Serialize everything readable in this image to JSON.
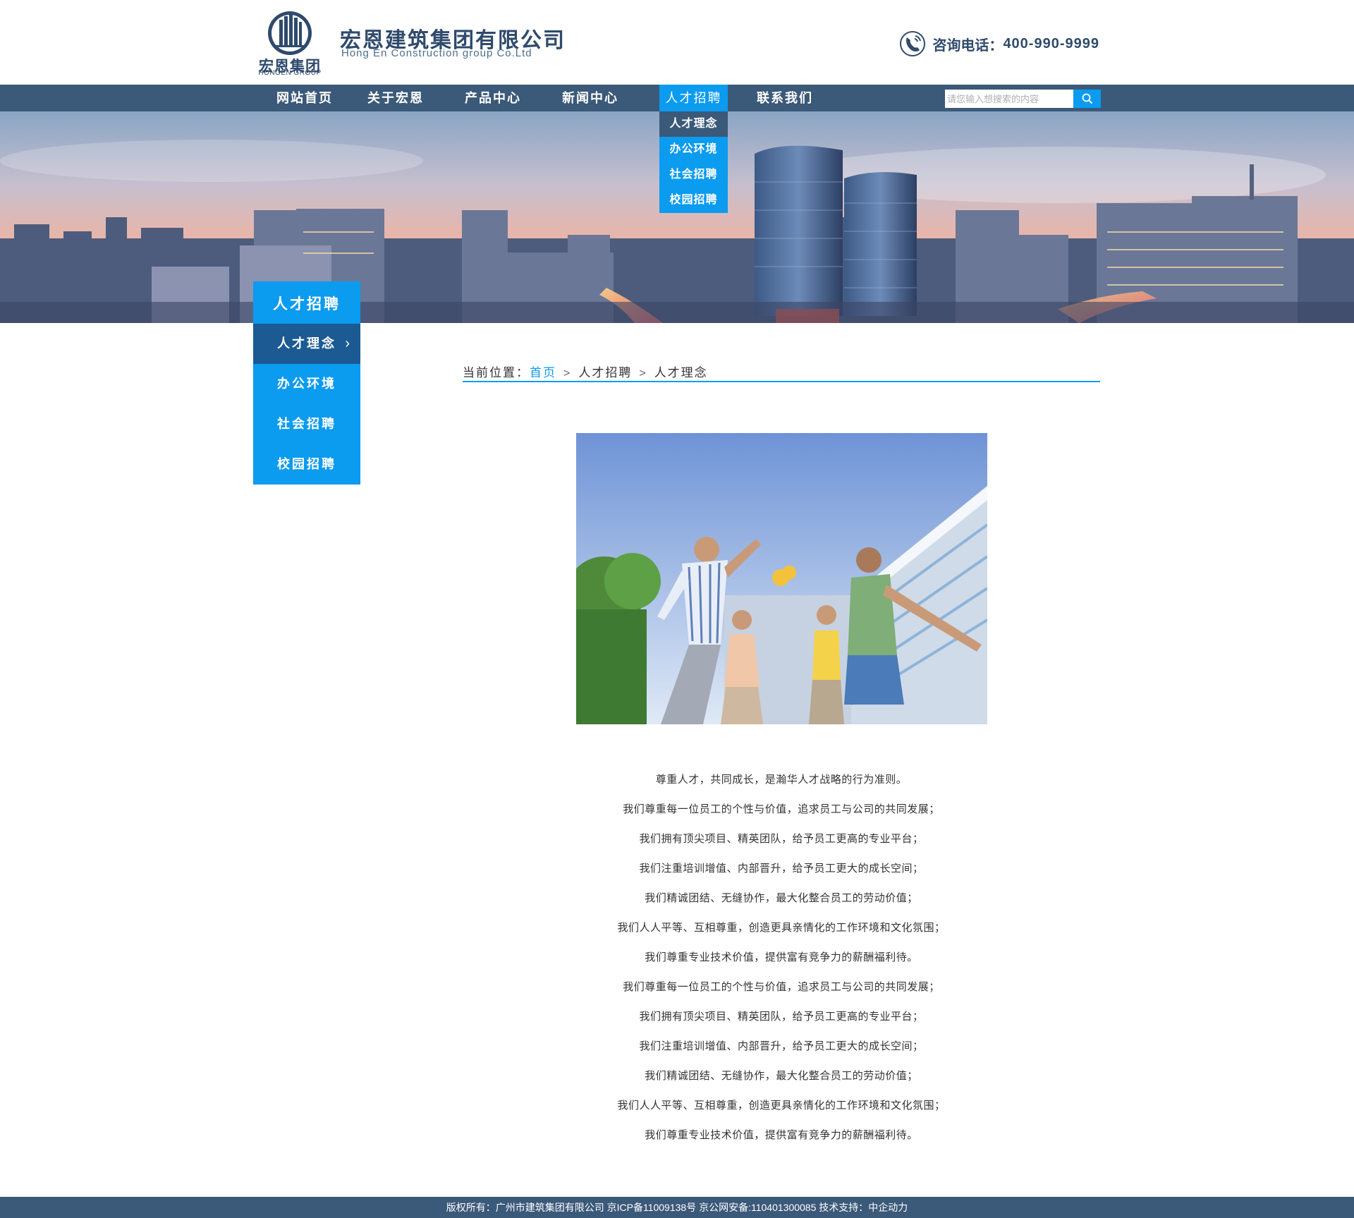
{
  "header": {
    "logo_cn": "宏恩集团",
    "logo_en": "HONGEN GROUP",
    "company_cn": "宏恩建筑集团有限公司",
    "company_en": "Hong En Construction group Co.Ltd",
    "hotline_label": "咨询电话：",
    "hotline_number": "400-990-9999",
    "phone_icon": "phone-icon",
    "brand_color": "#2f4a6c"
  },
  "nav": {
    "items": [
      {
        "label": "网站首页"
      },
      {
        "label": "关于宏恩"
      },
      {
        "label": "产品中心"
      },
      {
        "label": "新闻中心"
      },
      {
        "label": "人才招聘",
        "active": true
      },
      {
        "label": "联系我们"
      }
    ],
    "search_placeholder": "请您输入想搜索的内容",
    "search_icon": "search-icon",
    "bar_color": "#3b5979",
    "accent_color": "#0b9bef"
  },
  "dropdown": {
    "items": [
      {
        "label": "人才理念",
        "current": true
      },
      {
        "label": "办公环境"
      },
      {
        "label": "社会招聘"
      },
      {
        "label": "校园招聘"
      }
    ]
  },
  "side": {
    "title": "人才招聘",
    "items": [
      {
        "label": "人才理念",
        "current": true
      },
      {
        "label": "办公环境"
      },
      {
        "label": "社会招聘"
      },
      {
        "label": "校园招聘"
      }
    ],
    "arrow": "›"
  },
  "breadcrumb": {
    "prefix": "当前位置：",
    "home": "首页",
    "sep": ">",
    "level1": "人才招聘",
    "level2": "人才理念"
  },
  "content": {
    "lines": [
      "尊重人才，共同成长，是瀚华人才战略的行为准则。",
      "我们尊重每一位员工的个性与价值，追求员工与公司的共同发展；",
      "我们拥有顶尖项目、精英团队，给予员工更高的专业平台；",
      "我们注重培训增值、内部晋升，给予员工更大的成长空间；",
      "我们精诚团结、无缝协作，最大化整合员工的劳动价值；",
      "我们人人平等、互相尊重，创造更具亲情化的工作环境和文化氛围；",
      "我们尊重专业技术价值，提供富有竞争力的薪酬福利待。",
      "我们尊重每一位员工的个性与价值，追求员工与公司的共同发展；",
      "我们拥有顶尖项目、精英团队，给予员工更高的专业平台；",
      "我们注重培训增值、内部晋升，给予员工更大的成长空间；",
      "我们精诚团结、无缝协作，最大化整合员工的劳动价值；",
      "我们人人平等、互相尊重，创造更具亲情化的工作环境和文化氛围；",
      "我们尊重专业技术价值，提供富有竞争力的薪酬福利待。"
    ]
  },
  "footer": {
    "text": "版权所有：广州市建筑集团有限公司 京ICP备11009138号 京公网安备:110401300085 技术支持：中企动力"
  }
}
